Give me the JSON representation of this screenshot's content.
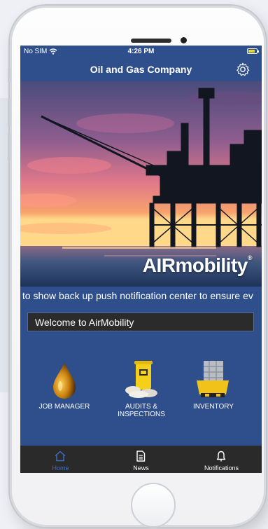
{
  "status_bar": {
    "carrier": "No SIM",
    "time": "4:26 PM"
  },
  "header": {
    "title": "Oil and Gas Company",
    "settings_icon": "gear-icon"
  },
  "hero": {
    "brand_text": "AIRmobility",
    "brand_mark": "®"
  },
  "ticker": {
    "text": "s to show back up push notification center to ensure ev"
  },
  "welcome": {
    "text": "Welcome to AirMobility"
  },
  "tiles": [
    {
      "label": "JOB MANAGER",
      "icon": "oil-drop-icon"
    },
    {
      "label": "AUDITS & INSPECTIONS",
      "icon": "spill-kit-icon"
    },
    {
      "label": "INVENTORY",
      "icon": "containment-pallet-icon"
    }
  ],
  "tabbar": {
    "tabs": [
      {
        "label": "Home",
        "icon": "home-icon",
        "active": true
      },
      {
        "label": "News",
        "icon": "news-icon",
        "active": false
      },
      {
        "label": "Notifications",
        "icon": "bell-icon",
        "active": false
      }
    ],
    "active_color": "#3b71c8"
  },
  "colors": {
    "app_blue": "#2f4f8c",
    "tabbar_bg": "#2a2a2a",
    "welcome_bg": "#2b2b2b"
  }
}
